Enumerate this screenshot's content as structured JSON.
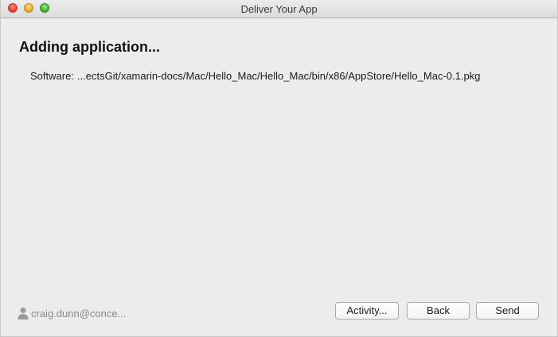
{
  "window": {
    "title": "Deliver Your App"
  },
  "main": {
    "heading": "Adding application...",
    "software_label": "Software:",
    "software_path": "...ectsGit/xamarin-docs/Mac/Hello_Mac/Hello_Mac/bin/x86/AppStore/Hello_Mac-0.1.pkg"
  },
  "footer": {
    "account": "craig.dunn@conce...",
    "account_icon": "person-icon",
    "buttons": {
      "activity": "Activity...",
      "back": "Back",
      "send": "Send"
    }
  }
}
